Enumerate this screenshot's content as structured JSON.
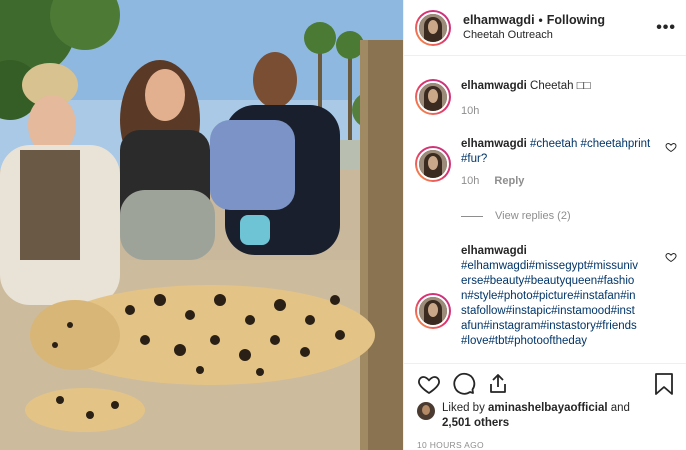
{
  "header": {
    "username": "elhamwagdi",
    "separator": "•",
    "follow_label": "Following",
    "location": "Cheetah Outreach",
    "more_icon": "more-horizontal-icon"
  },
  "comments": [
    {
      "username": "elhamwagdi",
      "text": "Cheetah □□",
      "time": "10h"
    },
    {
      "username": "elhamwagdi",
      "text": "#cheetah #cheetahprint #fur?",
      "time": "10h",
      "reply_label": "Reply",
      "view_replies": "View replies (2)"
    },
    {
      "username": "elhamwagdi",
      "text": "#elhamwagdi#missegypt#missuniverse#beauty#beautyqueen#fashion#style#photo#picture#instafan#instafollow#instapic#instamood#instafun#instagram#instastory#friends#love#tbt#photooftheday"
    }
  ],
  "actions": {
    "like_icon": "heart-icon",
    "comment_icon": "comment-icon",
    "share_icon": "share-icon",
    "save_icon": "bookmark-icon"
  },
  "likes": {
    "prefix": "Liked by ",
    "user": "aminashelbayaofficial",
    "middle": " and",
    "count": "2,501 others"
  },
  "timestamp": "10 HOURS AGO",
  "colors": {
    "hashtag": "#003569",
    "meta": "#8e8e8e",
    "story_ring_start": "#f9a03f",
    "story_ring_end": "#c13584"
  }
}
